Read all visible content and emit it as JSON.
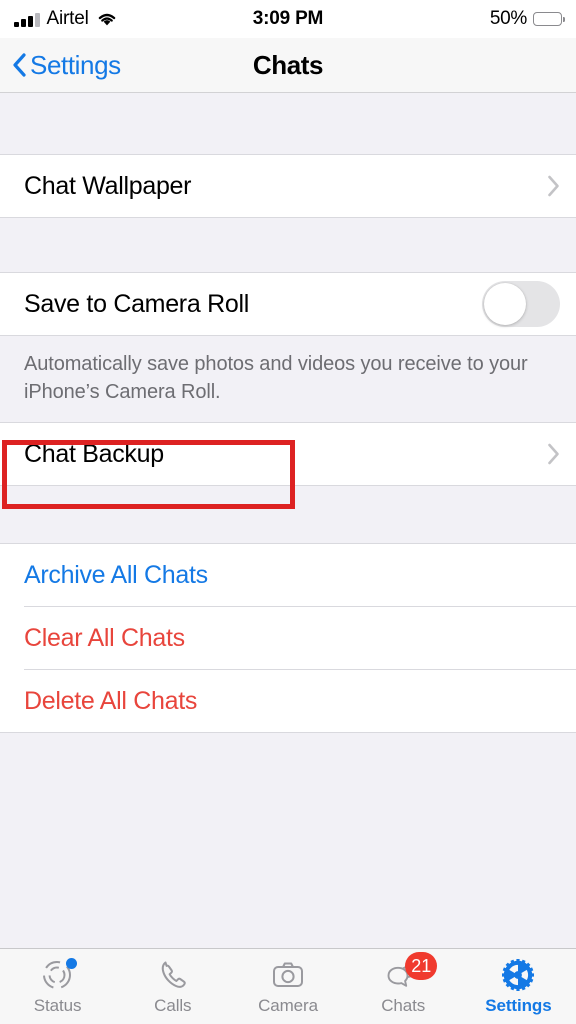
{
  "status_bar": {
    "carrier": "Airtel",
    "time": "3:09 PM",
    "battery_percent": "50%",
    "battery_level": 50,
    "signal_bars": 4,
    "wifi_icon": "wifi-icon"
  },
  "nav": {
    "back_label": "Settings",
    "title": "Chats",
    "back_icon": "chevron-left-icon",
    "accent_color": "#1479E5"
  },
  "sections": {
    "wallpaper": {
      "label": "Chat Wallpaper",
      "accessory_icon": "chevron-right-icon"
    },
    "camera_roll": {
      "label": "Save to Camera Roll",
      "toggle_state": "off",
      "footer": "Automatically save photos and videos you receive to your iPhone’s Camera Roll."
    },
    "backup": {
      "label": "Chat Backup",
      "accessory_icon": "chevron-right-icon",
      "highlighted": true,
      "highlight_color": "#DD2222"
    },
    "actions": [
      {
        "label": "Archive All Chats",
        "style": "blue"
      },
      {
        "label": "Clear All Chats",
        "style": "red"
      },
      {
        "label": "Delete All Chats",
        "style": "red"
      }
    ]
  },
  "tabbar": [
    {
      "label": "Status",
      "icon": "status-rings-icon",
      "active": false,
      "dot": true,
      "badge": null
    },
    {
      "label": "Calls",
      "icon": "phone-icon",
      "active": false,
      "dot": false,
      "badge": null
    },
    {
      "label": "Camera",
      "icon": "camera-icon",
      "active": false,
      "dot": false,
      "badge": null
    },
    {
      "label": "Chats",
      "icon": "chat-bubbles-icon",
      "active": false,
      "dot": false,
      "badge": "21"
    },
    {
      "label": "Settings",
      "icon": "gear-icon",
      "active": true,
      "dot": false,
      "badge": null
    }
  ]
}
